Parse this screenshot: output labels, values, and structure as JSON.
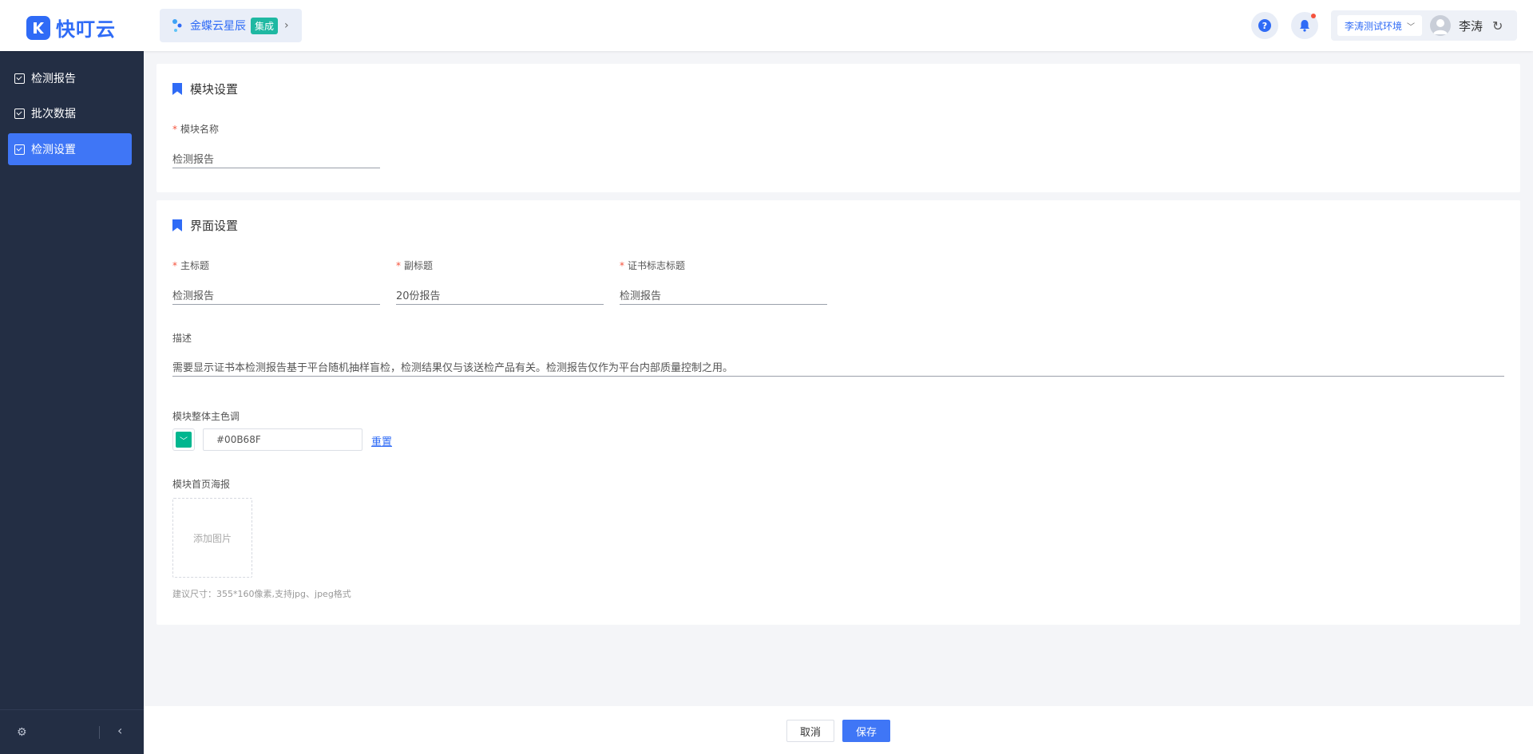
{
  "header": {
    "logo_text": "快叮云",
    "app_name": "金蝶云星辰",
    "app_tag": "集成",
    "env_label": "李涛测试环境",
    "user_name": "李涛"
  },
  "sidebar": {
    "items": [
      {
        "label": "检测报告",
        "active": false
      },
      {
        "label": "批次数据",
        "active": false
      },
      {
        "label": "检测设置",
        "active": true
      }
    ]
  },
  "module_settings": {
    "title": "模块设置",
    "name_label": "模块名称",
    "name_value": "检测报告"
  },
  "ui_settings": {
    "title": "界面设置",
    "main_title_label": "主标题",
    "main_title_value": "检测报告",
    "subtitle_label": "副标题",
    "subtitle_value": "20份报告",
    "cert_title_label": "证书标志标题",
    "cert_title_value": "检测报告",
    "desc_label": "描述",
    "desc_value": "需要显示证书本检测报告基于平台随机抽样盲检，检测结果仅与该送检产品有关。检测报告仅作为平台内部质量控制之用。",
    "color_label": "模块整体主色调",
    "color_value": "#00B68F",
    "reset_label": "重置",
    "poster_label": "模块首页海报",
    "upload_label": "添加图片",
    "hint": "建议尺寸：355*160像素,支持jpg、jpeg格式"
  },
  "footer": {
    "cancel_label": "取消",
    "save_label": "保存"
  },
  "colors": {
    "accent": "#3f76f6",
    "sidebar_bg": "#232e44",
    "theme": "#00B68F"
  }
}
